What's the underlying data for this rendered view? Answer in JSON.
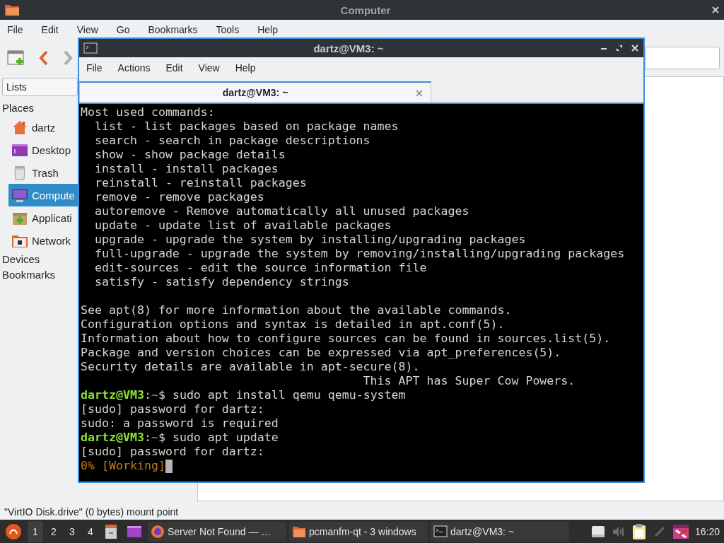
{
  "file_manager": {
    "title": "Computer",
    "menu": [
      "File",
      "Edit",
      "View",
      "Go",
      "Bookmarks",
      "Tools",
      "Help"
    ],
    "sidebar": {
      "view_mode": "Lists",
      "sections": [
        {
          "label": "Places",
          "items": [
            {
              "label": "dartz",
              "kind": "home",
              "selected": false
            },
            {
              "label": "Desktop",
              "kind": "desktop",
              "selected": false
            },
            {
              "label": "Trash",
              "kind": "trash",
              "selected": false
            },
            {
              "label": "Compute",
              "kind": "computer",
              "selected": true
            },
            {
              "label": "Applicati",
              "kind": "applications",
              "selected": false
            },
            {
              "label": "Network",
              "kind": "network",
              "selected": false
            }
          ]
        },
        {
          "label": "Devices"
        },
        {
          "label": "Bookmarks"
        }
      ]
    },
    "status_bar": "\"VirtIO Disk.drive\" (0 bytes) mount point"
  },
  "terminal": {
    "title": "dartz@VM3: ~",
    "menu": [
      "File",
      "Actions",
      "Edit",
      "View",
      "Help"
    ],
    "tabs": [
      {
        "label": "dartz@VM3: ~",
        "selected": true
      }
    ],
    "lines": [
      {
        "kind": "text",
        "segments": [
          {
            "kind": "plain",
            "text": "Most used commands:"
          }
        ]
      },
      {
        "kind": "text",
        "segments": [
          {
            "kind": "plain",
            "text": "  list - list packages based on package names"
          }
        ]
      },
      {
        "kind": "text",
        "segments": [
          {
            "kind": "plain",
            "text": "  search - search in package descriptions"
          }
        ]
      },
      {
        "kind": "text",
        "segments": [
          {
            "kind": "plain",
            "text": "  show - show package details"
          }
        ]
      },
      {
        "kind": "text",
        "segments": [
          {
            "kind": "plain",
            "text": "  install - install packages"
          }
        ]
      },
      {
        "kind": "text",
        "segments": [
          {
            "kind": "plain",
            "text": "  reinstall - reinstall packages"
          }
        ]
      },
      {
        "kind": "text",
        "segments": [
          {
            "kind": "plain",
            "text": "  remove - remove packages"
          }
        ]
      },
      {
        "kind": "text",
        "segments": [
          {
            "kind": "plain",
            "text": "  autoremove - Remove automatically all unused packages"
          }
        ]
      },
      {
        "kind": "text",
        "segments": [
          {
            "kind": "plain",
            "text": "  update - update list of available packages"
          }
        ]
      },
      {
        "kind": "text",
        "segments": [
          {
            "kind": "plain",
            "text": "  upgrade - upgrade the system by installing/upgrading packages"
          }
        ]
      },
      {
        "kind": "text",
        "segments": [
          {
            "kind": "plain",
            "text": "  full-upgrade - upgrade the system by removing/installing/upgrading packages"
          }
        ]
      },
      {
        "kind": "text",
        "segments": [
          {
            "kind": "plain",
            "text": "  edit-sources - edit the source information file"
          }
        ]
      },
      {
        "kind": "text",
        "segments": [
          {
            "kind": "plain",
            "text": "  satisfy - satisfy dependency strings"
          }
        ]
      },
      {
        "kind": "blank"
      },
      {
        "kind": "text",
        "segments": [
          {
            "kind": "plain",
            "text": "See apt(8) for more information about the available commands."
          }
        ]
      },
      {
        "kind": "text",
        "segments": [
          {
            "kind": "plain",
            "text": "Configuration options and syntax is detailed in apt.conf(5)."
          }
        ]
      },
      {
        "kind": "text",
        "segments": [
          {
            "kind": "plain",
            "text": "Information about how to configure sources can be found in sources.list(5)."
          }
        ]
      },
      {
        "kind": "text",
        "segments": [
          {
            "kind": "plain",
            "text": "Package and version choices can be expressed via apt_preferences(5)."
          }
        ]
      },
      {
        "kind": "text",
        "segments": [
          {
            "kind": "plain",
            "text": "Security details are available in apt-secure(8)."
          }
        ]
      },
      {
        "kind": "text",
        "segments": [
          {
            "kind": "plain",
            "text": "                                        This APT has Super Cow Powers."
          }
        ]
      },
      {
        "kind": "text",
        "segments": [
          {
            "kind": "user",
            "text": "dartz@VM3"
          },
          {
            "kind": "plain",
            "text": ":"
          },
          {
            "kind": "path",
            "text": "~"
          },
          {
            "kind": "plain",
            "text": "$ sudo apt install qemu qemu-system"
          }
        ]
      },
      {
        "kind": "text",
        "segments": [
          {
            "kind": "plain",
            "text": "[sudo] password for dartz:"
          }
        ]
      },
      {
        "kind": "text",
        "segments": [
          {
            "kind": "plain",
            "text": "sudo: a password is required"
          }
        ]
      },
      {
        "kind": "text",
        "segments": [
          {
            "kind": "user",
            "text": "dartz@VM3"
          },
          {
            "kind": "plain",
            "text": ":"
          },
          {
            "kind": "path",
            "text": "~"
          },
          {
            "kind": "plain",
            "text": "$ sudo apt update"
          }
        ]
      },
      {
        "kind": "text",
        "segments": [
          {
            "kind": "plain",
            "text": "[sudo] password for dartz:"
          }
        ]
      },
      {
        "kind": "text",
        "segments": [
          {
            "kind": "progress",
            "text": "0% [Working]"
          }
        ],
        "cursor": true
      }
    ]
  },
  "taskbar": {
    "workspaces": [
      {
        "label": "1",
        "selected": true
      },
      {
        "label": "2",
        "selected": false
      },
      {
        "label": "3",
        "selected": false
      },
      {
        "label": "4",
        "selected": false
      }
    ],
    "tasks": [
      {
        "label": "Server Not Found — …",
        "kind": "browser"
      },
      {
        "label": "pcmanfm-qt - 3 windows",
        "kind": "folder"
      },
      {
        "label": "dartz@VM3: ~",
        "kind": "terminal"
      }
    ],
    "clock": "16:20"
  }
}
